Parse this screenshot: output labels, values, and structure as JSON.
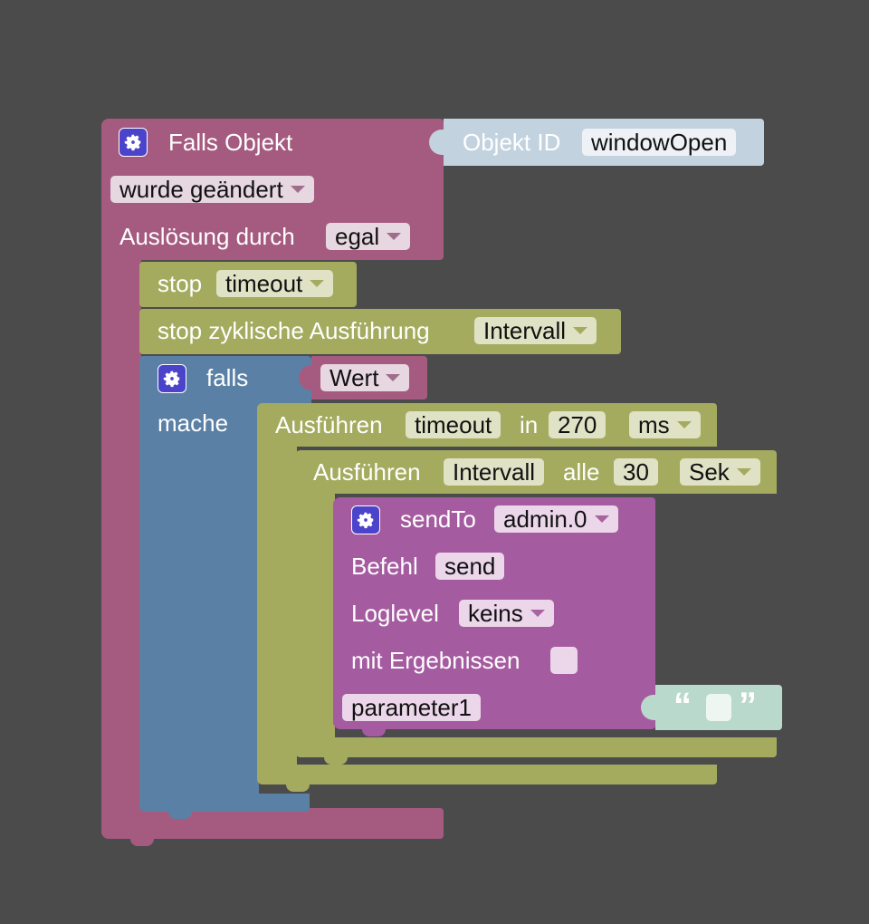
{
  "trigger": {
    "title": "Falls Objekt",
    "object_id_label": "Objekt ID",
    "object_id_value": "windowOpen",
    "change_value": "wurde geändert",
    "trigger_by_label": "Auslösung durch",
    "trigger_by_value": "egal"
  },
  "stop_timeout": {
    "label": "stop",
    "value": "timeout"
  },
  "stop_interval": {
    "label": "stop zyklische Ausführung",
    "value": "Intervall"
  },
  "if_block": {
    "if_label": "falls",
    "do_label": "mache",
    "condition_value": "Wert"
  },
  "timeout_block": {
    "label": "Ausführen",
    "name": "timeout",
    "in_label": "in",
    "delay": "270",
    "unit": "ms"
  },
  "interval_block": {
    "label": "Ausführen",
    "name": "Intervall",
    "every_label": "alle",
    "period": "30",
    "unit": "Sek"
  },
  "sendto_block": {
    "label": "sendTo",
    "instance": "admin.0",
    "command_label": "Befehl",
    "command_value": "send",
    "loglevel_label": "Loglevel",
    "loglevel_value": "keins",
    "results_label": "mit Ergebnissen",
    "param_label": "parameter1",
    "quote_open": "“",
    "quote_close": "”"
  },
  "colors": {
    "trigger": "#a55b80",
    "olive": "#a4ab5f",
    "blue": "#5b80a5",
    "magenta": "#a55ba0",
    "object_id": "#c3d2df",
    "text": "#b9d9cd",
    "gear": "#4b43c9"
  }
}
